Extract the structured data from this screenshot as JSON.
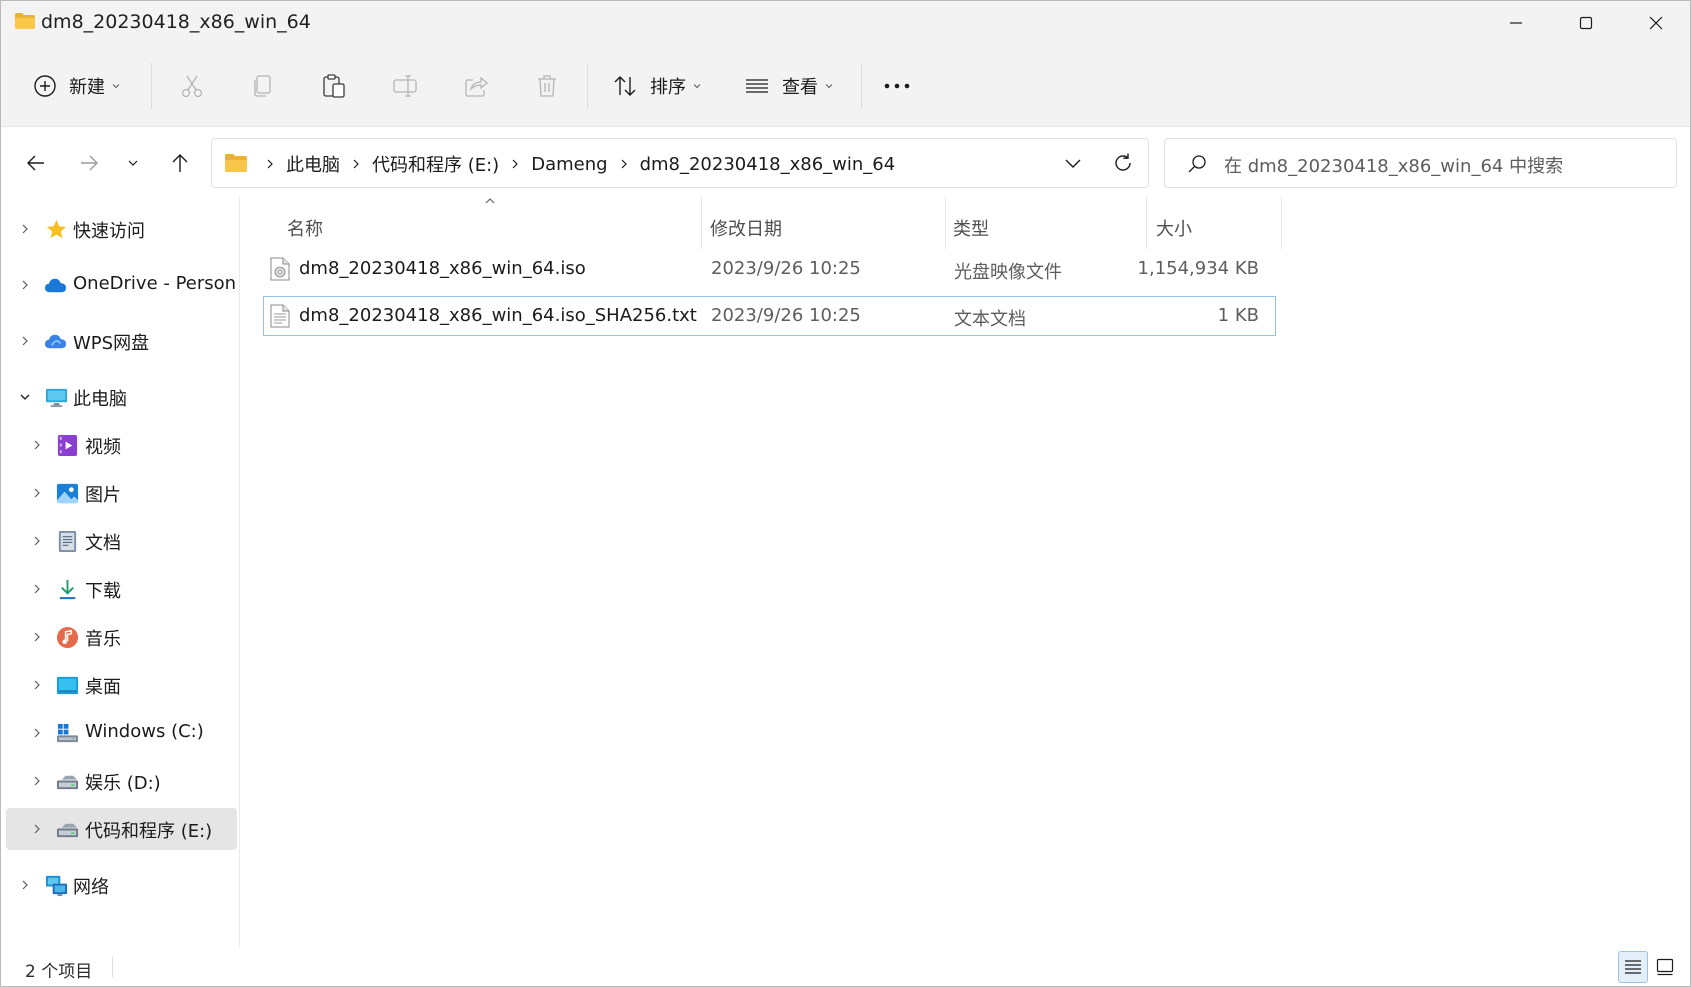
{
  "window": {
    "title": "dm8_20230418_x86_win_64",
    "controls": {
      "minimize": "minimize",
      "maximize": "maximize",
      "close": "close"
    }
  },
  "toolbar": {
    "new_label": "新建",
    "sort_label": "排序",
    "view_label": "查看",
    "more_label": "···"
  },
  "address": {
    "crumbs": [
      "此电脑",
      "代码和程序 (E:)",
      "Dameng",
      "dm8_20230418_x86_win_64"
    ]
  },
  "search": {
    "placeholder": "在 dm8_20230418_x86_win_64 中搜索"
  },
  "sidebar": {
    "items": [
      {
        "label": "快速访问",
        "icon": "star-icon"
      },
      {
        "label": "OneDrive - Personal",
        "icon": "onedrive-cloud-icon"
      },
      {
        "label": "WPS网盘",
        "icon": "wps-cloud-icon"
      },
      {
        "label": "此电脑",
        "icon": "computer-icon"
      },
      {
        "label": "视频",
        "icon": "video-icon"
      },
      {
        "label": "图片",
        "icon": "pictures-icon"
      },
      {
        "label": "文档",
        "icon": "documents-icon"
      },
      {
        "label": "下载",
        "icon": "download-icon"
      },
      {
        "label": "音乐",
        "icon": "music-icon"
      },
      {
        "label": "桌面",
        "icon": "desktop-icon"
      },
      {
        "label": "Windows (C:)",
        "icon": "windows-drive-icon"
      },
      {
        "label": "娱乐 (D:)",
        "icon": "drive-icon"
      },
      {
        "label": "代码和程序 (E:)",
        "icon": "drive-icon"
      },
      {
        "label": "网络",
        "icon": "network-icon"
      }
    ]
  },
  "files": {
    "columns": [
      "名称",
      "修改日期",
      "类型",
      "大小"
    ],
    "rows": [
      {
        "name": "dm8_20230418_x86_win_64.iso",
        "modified": "2023/9/26 10:25",
        "type": "光盘映像文件",
        "size": "1,154,934 KB",
        "icon": "disc-image-file-icon"
      },
      {
        "name": "dm8_20230418_x86_win_64.iso_SHA256.txt",
        "modified": "2023/9/26 10:25",
        "type": "文本文档",
        "size": "1 KB",
        "icon": "text-file-icon"
      }
    ]
  },
  "status": {
    "item_count": "2 个项目"
  },
  "colors": {
    "accent": "#0067c0",
    "folder": "#f8c648",
    "selection": "#e5e5e5",
    "focus_border": "#99c1e8"
  }
}
